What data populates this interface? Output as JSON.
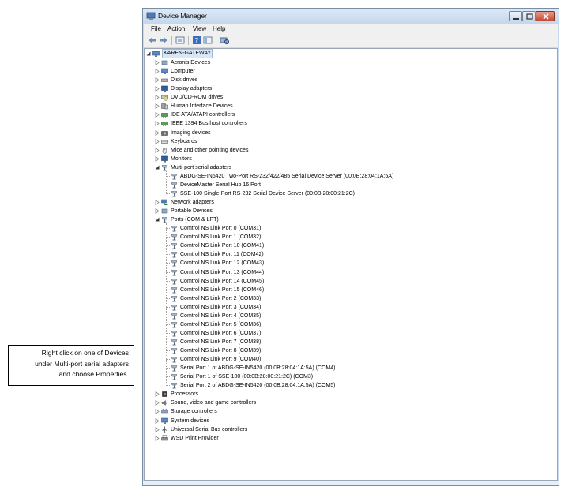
{
  "callout": {
    "lines": [
      "Right click on one of Devices",
      "under Multi-port serial adapters",
      "and choose Properties."
    ]
  },
  "window": {
    "title": "Device Manager",
    "menu": [
      "File",
      "Action",
      "View",
      "Help"
    ],
    "toolbar_icons": [
      "back-icon",
      "forward-icon",
      "properties-icon",
      "help-icon",
      "view-icon",
      "scan-hardware-icon"
    ]
  },
  "tree": [
    {
      "level": 0,
      "label": "KAREN-GATEWAY",
      "icon": "computer-icon",
      "expanded": true,
      "selected": true
    },
    {
      "level": 1,
      "label": "Acronis Devices",
      "icon": "device-icon",
      "expanded": false
    },
    {
      "level": 1,
      "label": "Computer",
      "icon": "computer-icon",
      "expanded": false
    },
    {
      "level": 1,
      "label": "Disk drives",
      "icon": "disk-icon",
      "expanded": false
    },
    {
      "level": 1,
      "label": "Display adapters",
      "icon": "monitor-icon",
      "expanded": false
    },
    {
      "level": 1,
      "label": "DVD/CD-ROM drives",
      "icon": "dvd-icon",
      "expanded": false
    },
    {
      "level": 1,
      "label": "Human Interface Devices",
      "icon": "hid-icon",
      "expanded": false
    },
    {
      "level": 1,
      "label": "IDE ATA/ATAPI controllers",
      "icon": "controller-icon",
      "expanded": false
    },
    {
      "level": 1,
      "label": "IEEE 1394 Bus host controllers",
      "icon": "controller-icon",
      "expanded": false
    },
    {
      "level": 1,
      "label": "Imaging devices",
      "icon": "camera-icon",
      "expanded": false
    },
    {
      "level": 1,
      "label": "Keyboards",
      "icon": "keyboard-icon",
      "expanded": false
    },
    {
      "level": 1,
      "label": "Mice and other pointing devices",
      "icon": "mouse-icon",
      "expanded": false
    },
    {
      "level": 1,
      "label": "Monitors",
      "icon": "monitor-icon",
      "expanded": false
    },
    {
      "level": 1,
      "label": "Multi-port serial adapters",
      "icon": "port-icon",
      "expanded": true
    },
    {
      "level": 2,
      "label": "ABDG-SE-IN5420 Two-Port RS-232/422/485 Serial Device Server (00:0B:28:04:1A:5A)",
      "icon": "port-icon"
    },
    {
      "level": 2,
      "label": "DeviceMaster Serial Hub 16 Port",
      "icon": "port-icon"
    },
    {
      "level": 2,
      "label": "SSE-100 Single-Port RS-232 Serial Device Server (00:0B:28:00:21:2C)",
      "icon": "port-icon"
    },
    {
      "level": 1,
      "label": "Network adapters",
      "icon": "network-icon",
      "expanded": false
    },
    {
      "level": 1,
      "label": "Portable Devices",
      "icon": "device-icon",
      "expanded": false
    },
    {
      "level": 1,
      "label": "Ports (COM & LPT)",
      "icon": "port-icon",
      "expanded": true
    },
    {
      "level": 2,
      "label": "Comtrol NS Link Port 0 (COM31)",
      "icon": "port-icon"
    },
    {
      "level": 2,
      "label": "Comtrol NS Link Port 1 (COM32)",
      "icon": "port-icon"
    },
    {
      "level": 2,
      "label": "Comtrol NS Link Port 10 (COM41)",
      "icon": "port-icon"
    },
    {
      "level": 2,
      "label": "Comtrol NS Link Port 11 (COM42)",
      "icon": "port-icon"
    },
    {
      "level": 2,
      "label": "Comtrol NS Link Port 12 (COM43)",
      "icon": "port-icon"
    },
    {
      "level": 2,
      "label": "Comtrol NS Link Port 13 (COM44)",
      "icon": "port-icon"
    },
    {
      "level": 2,
      "label": "Comtrol NS Link Port 14 (COM45)",
      "icon": "port-icon"
    },
    {
      "level": 2,
      "label": "Comtrol NS Link Port 15 (COM46)",
      "icon": "port-icon"
    },
    {
      "level": 2,
      "label": "Comtrol NS Link Port 2 (COM33)",
      "icon": "port-icon"
    },
    {
      "level": 2,
      "label": "Comtrol NS Link Port 3 (COM34)",
      "icon": "port-icon"
    },
    {
      "level": 2,
      "label": "Comtrol NS Link Port 4 (COM35)",
      "icon": "port-icon"
    },
    {
      "level": 2,
      "label": "Comtrol NS Link Port 5 (COM36)",
      "icon": "port-icon"
    },
    {
      "level": 2,
      "label": "Comtrol NS Link Port 6 (COM37)",
      "icon": "port-icon"
    },
    {
      "level": 2,
      "label": "Comtrol NS Link Port 7 (COM38)",
      "icon": "port-icon"
    },
    {
      "level": 2,
      "label": "Comtrol NS Link Port 8 (COM39)",
      "icon": "port-icon"
    },
    {
      "level": 2,
      "label": "Comtrol NS Link Port 9 (COM40)",
      "icon": "port-icon"
    },
    {
      "level": 2,
      "label": "Serial Port 1 of ABDG-SE-IN5420 (00:0B:28:04:1A:5A) (COM4)",
      "icon": "port-icon"
    },
    {
      "level": 2,
      "label": "Serial Port 1 of SSE-100 (00:0B:28:00:21:2C) (COM3)",
      "icon": "port-icon"
    },
    {
      "level": 2,
      "label": "Serial Port 2 of ABDG-SE-IN5420 (00:0B:28:04:1A:5A) (COM5)",
      "icon": "port-icon"
    },
    {
      "level": 1,
      "label": "Processors",
      "icon": "cpu-icon",
      "expanded": false
    },
    {
      "level": 1,
      "label": "Sound, video and game controllers",
      "icon": "speaker-icon",
      "expanded": false
    },
    {
      "level": 1,
      "label": "Storage controllers",
      "icon": "storage-icon",
      "expanded": false
    },
    {
      "level": 1,
      "label": "System devices",
      "icon": "computer-icon",
      "expanded": false
    },
    {
      "level": 1,
      "label": "Universal Serial Bus controllers",
      "icon": "usb-icon",
      "expanded": false
    },
    {
      "level": 1,
      "label": "WSD Print Provider",
      "icon": "printer-icon",
      "expanded": false
    }
  ],
  "colors": {
    "arrow": "#e8141b",
    "selection": "#d8e6f5"
  }
}
